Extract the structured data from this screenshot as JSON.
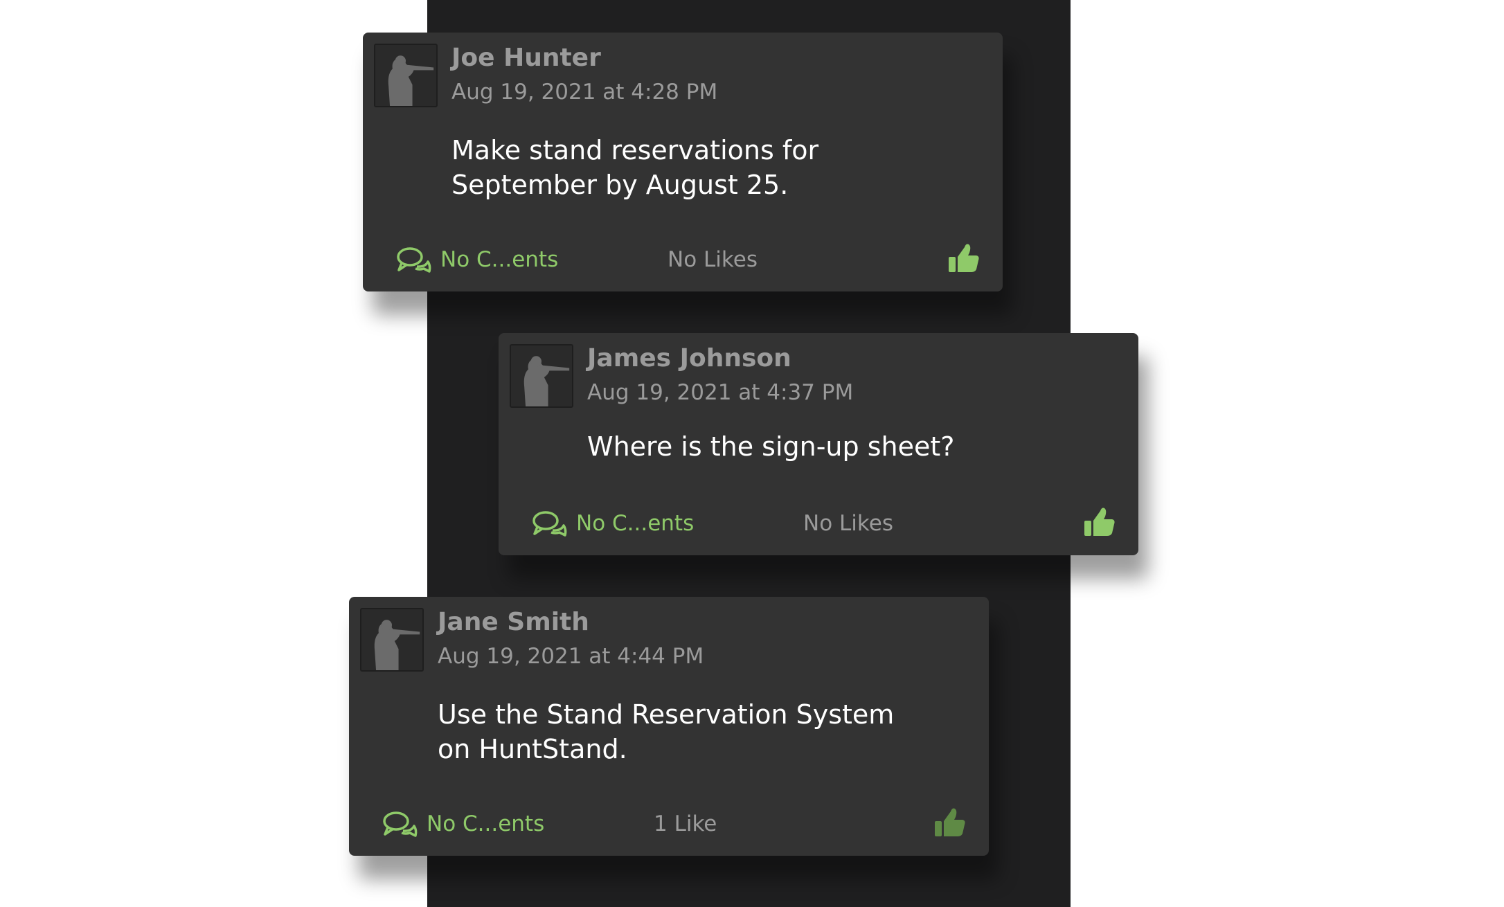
{
  "accent_color": "#8fca69",
  "posts": [
    {
      "author": "Joe Hunter",
      "timestamp": "Aug 19, 2021 at 4:28 PM",
      "message": "Make stand reservations for September by August 25.",
      "comments_label": "No C...ents",
      "likes_label": "No Likes",
      "like_icon_color": "#8fca69"
    },
    {
      "author": "James Johnson",
      "timestamp": "Aug 19, 2021 at 4:37 PM",
      "message": "Where is the sign-up sheet?",
      "comments_label": "No C...ents",
      "likes_label": "No Likes",
      "like_icon_color": "#8fca69"
    },
    {
      "author": "Jane Smith",
      "timestamp": "Aug 19, 2021 at 4:44 PM",
      "message": "Use the Stand Reservation System on HuntStand.",
      "comments_label": "No C...ents",
      "likes_label": "1 Like",
      "like_icon_color": "#5f8a45"
    }
  ]
}
